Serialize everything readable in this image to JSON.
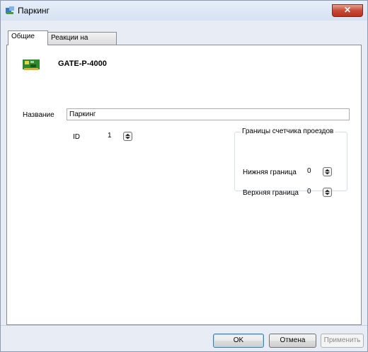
{
  "window": {
    "title": "Паркинг",
    "close_label": "✕",
    "accent_color": "#c74a36"
  },
  "tabs": [
    {
      "label": "Общие",
      "active": true
    },
    {
      "label": "Реакции на события",
      "active": false
    }
  ],
  "device": {
    "name": "GATE-P-4000",
    "icon": "controller-board-icon"
  },
  "form": {
    "name_label": "Название",
    "name_value": "Паркинг",
    "id_label": "ID",
    "id_value": "1"
  },
  "counter_group": {
    "caption": "Границы счетчика проездов",
    "lower_label": "Нижняя граница",
    "lower_value": "0",
    "upper_label": "Верхняя граница",
    "upper_value": "0"
  },
  "buttons": {
    "ok": "OK",
    "cancel": "Отмена",
    "apply": "Применить"
  }
}
